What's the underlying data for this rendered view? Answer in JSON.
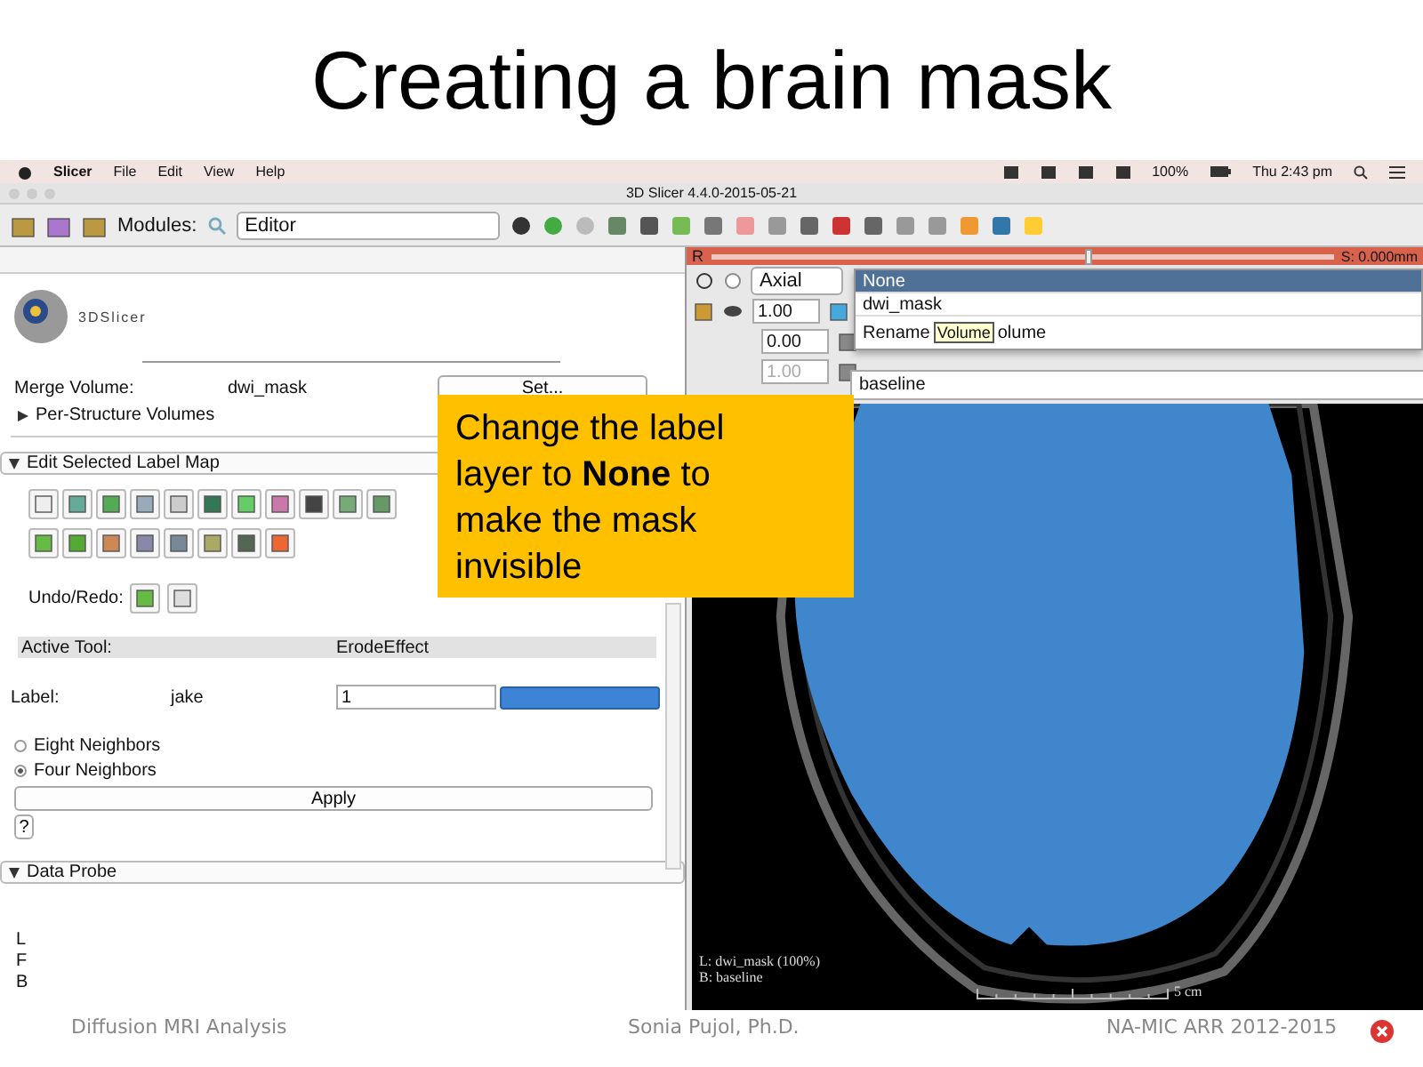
{
  "slide_title": "Creating a brain mask",
  "menu_bar": {
    "app": "Slicer",
    "items": [
      "File",
      "Edit",
      "View",
      "Help"
    ],
    "battery": "100%",
    "clock": "Thu 2:43 pm"
  },
  "window": {
    "title": "3D Slicer 4.4.0-2015-05-21"
  },
  "toolbar": {
    "modules_label": "Modules:",
    "module": "Editor"
  },
  "module_panel": {
    "logo": "3DSlicer",
    "merge_volume_label": "Merge Volume:",
    "merge_volume": "dwi_mask",
    "set_button": "Set...",
    "sections": [
      {
        "title": "Per-Structure Volumes",
        "expanded": false
      },
      {
        "title": "Edit Selected Label Map",
        "expanded": true
      },
      {
        "title": "Data Probe",
        "expanded": true
      }
    ],
    "undo_label": "Undo/Redo:",
    "active_tool_label": "Active Tool:",
    "active_tool": "ErodeEffect",
    "label_label": "Label:",
    "label_name": "jake",
    "label_value": "1",
    "neighbors": [
      {
        "label": "Eight Neighbors",
        "selected": false
      },
      {
        "label": "Four Neighbors",
        "selected": true
      }
    ],
    "apply_button": "Apply",
    "help_button": "?",
    "probe_letters": [
      "L",
      "F",
      "B"
    ]
  },
  "viewer": {
    "slice_label": "R",
    "slice_level": {
      "level": 0.6
    },
    "offset": "S: 0.000mm",
    "orientation": "Axial",
    "opacity": "1.00",
    "values": [
      "0.00",
      "1.00"
    ],
    "dropdown": [
      {
        "label": "None",
        "selected": true
      },
      {
        "label": "dwi_mask",
        "selected": false
      }
    ],
    "rename_item": {
      "start": "Rename",
      "end": "olume"
    },
    "tooltip": "Volume",
    "background": "baseline",
    "overlay_lines": [
      "L: dwi_mask (100%)",
      "B: baseline"
    ],
    "scale": "5 cm"
  },
  "callout": "Change the label layer to **None** to make the mask invisible",
  "footer": [
    "Diffusion MRI Analysis",
    "Sonia Pujol, Ph.D.",
    "NA-MIC ARR 2012-2015"
  ]
}
